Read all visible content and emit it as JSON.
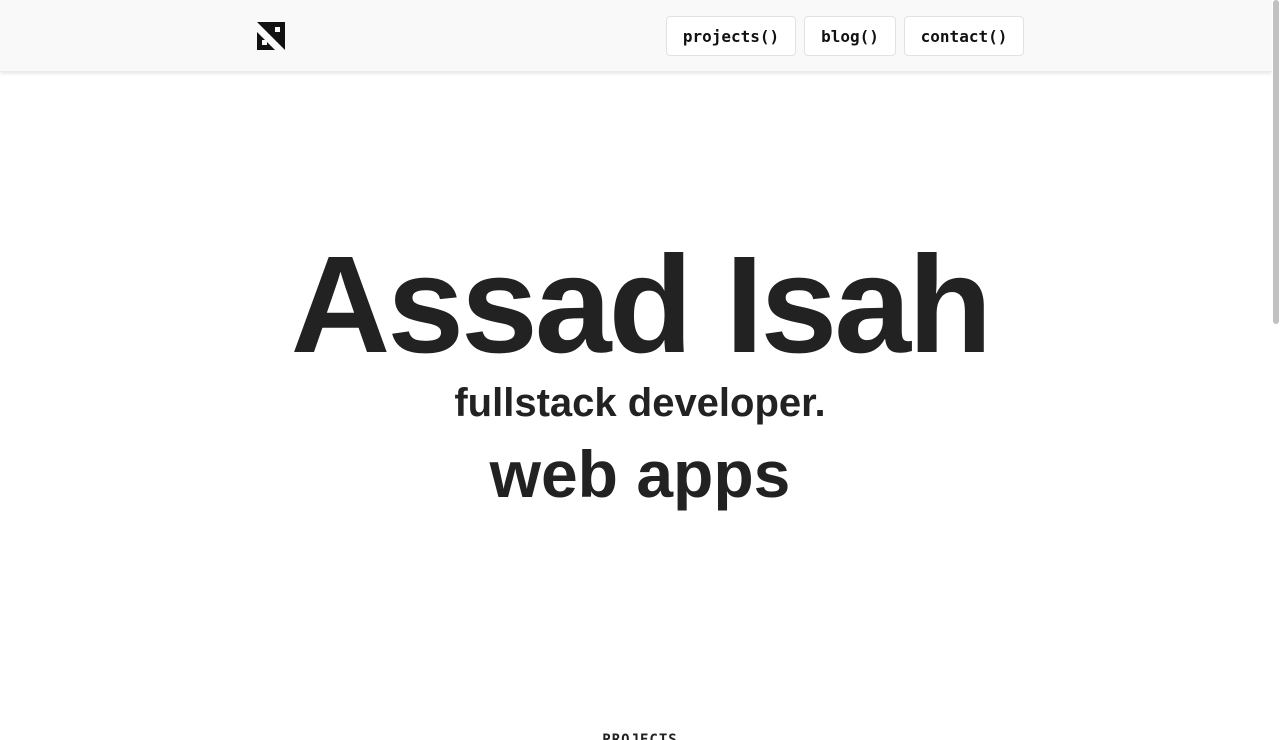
{
  "header": {
    "logo_icon": "monogram-logo-icon",
    "nav": {
      "projects_label": "projects()",
      "blog_label": "blog()",
      "contact_label": "contact()"
    }
  },
  "hero": {
    "name": "Assad Isah",
    "role": "fullstack developer.",
    "typed_text": "web apps"
  },
  "sections": {
    "projects_heading": "PROJECTS"
  },
  "colors": {
    "text": "#222222",
    "header_bg": "#f9f9f9",
    "button_border": "#e2e2e2",
    "background": "#ffffff"
  }
}
